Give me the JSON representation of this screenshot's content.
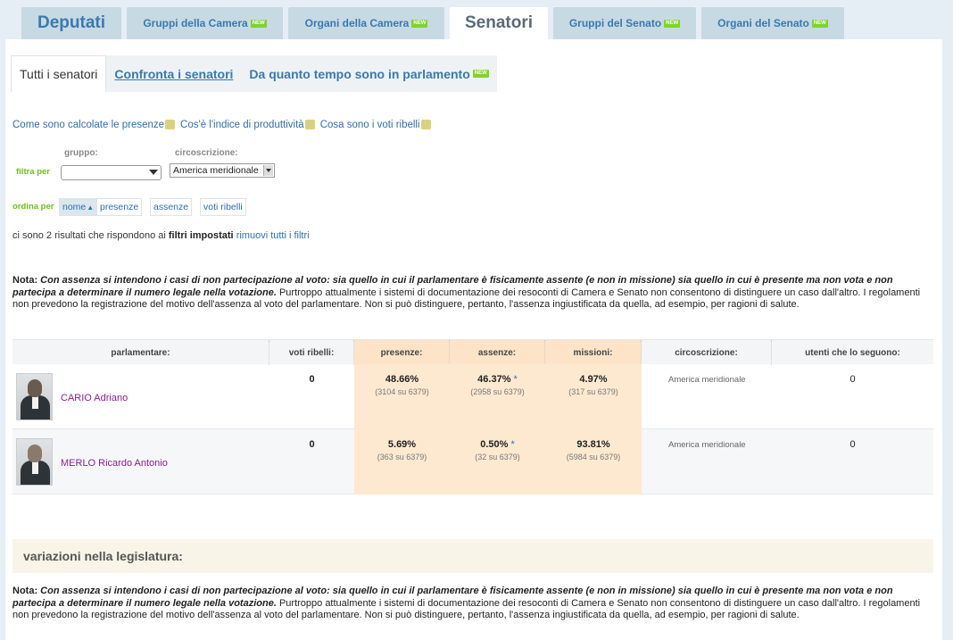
{
  "top_tabs": [
    {
      "label": "Deputati",
      "new": false
    },
    {
      "label": "Gruppi della Camera",
      "new": true
    },
    {
      "label": "Organi della Camera",
      "new": true
    },
    {
      "label": "Senatori",
      "new": false
    },
    {
      "label": "Gruppi del Senato",
      "new": true
    },
    {
      "label": "Organi del Senato",
      "new": true
    }
  ],
  "new_badge": "NEW",
  "sub_tabs": [
    {
      "label": "Tutti i senatori"
    },
    {
      "label": "Confronta i senatori"
    },
    {
      "label": "Da quanto tempo sono in parlamento"
    }
  ],
  "info_links": [
    "Come sono calcolate le presenze",
    "Cos'è l'indice di produttività",
    "Cosa sono i voti ribelli"
  ],
  "filters": {
    "filter_label": "filtra per",
    "gruppo_label": "gruppo:",
    "gruppo_value": "",
    "circoscrizione_label": "circoscrizione:",
    "circoscrizione_value": "America meridionale"
  },
  "sort": {
    "label": "ordina per",
    "buttons": [
      "nome",
      "presenze",
      "assenze",
      "voti ribelli"
    ]
  },
  "results": {
    "prefix": "ci sono 2 risultati che rispondono ai",
    "bold": "filtri impostati",
    "link": "rimuovi tutti i filtri"
  },
  "nota": {
    "label": "Nota:",
    "italic": "Con assenza si intendono i casi di non partecipazione al voto: sia quello in cui il parlamentare è fisicamente assente (e non in missione) sia quello in cui è presente ma non vota e non partecipa a determinare il numero legale nella votazione.",
    "text": "Purtroppo attualmente i sistemi di documentazione dei resoconti di Camera e Senato non consentono di distinguere un caso dall'altro. I regolamenti non prevedono la registrazione del motivo dell'assenza al voto del parlamentare. Non si può distinguere, pertanto, l'assenza ingiustificata da quella, ad esempio, per ragioni di salute."
  },
  "table": {
    "headers": [
      "parlamentare:",
      "voti ribelli:",
      "presenze:",
      "assenze:",
      "missioni:",
      "circoscrizione:",
      "utenti che lo seguono:"
    ],
    "rows": [
      {
        "name": "CARIO Adriano",
        "voti_ribelli": "0",
        "presenze": "48.66%",
        "presenze_sub": "(3104 su 6379)",
        "assenze": "46.37%",
        "assenze_sub": "(2958 su 6379)",
        "missioni": "4.97%",
        "missioni_sub": "(317 su 6379)",
        "circoscrizione": "America meridionale",
        "utenti": "0"
      },
      {
        "name": "MERLO Ricardo Antonio",
        "voti_ribelli": "0",
        "presenze": "5.69%",
        "presenze_sub": "(363 su 6379)",
        "assenze": "0.50%",
        "assenze_sub": "(32 su 6379)",
        "missioni": "93.81%",
        "missioni_sub": "(5984 su 6379)",
        "circoscrizione": "America meridionale",
        "utenti": "0"
      }
    ],
    "asterisk": "*"
  },
  "variazioni_title": "variazioni nella legislatura:"
}
